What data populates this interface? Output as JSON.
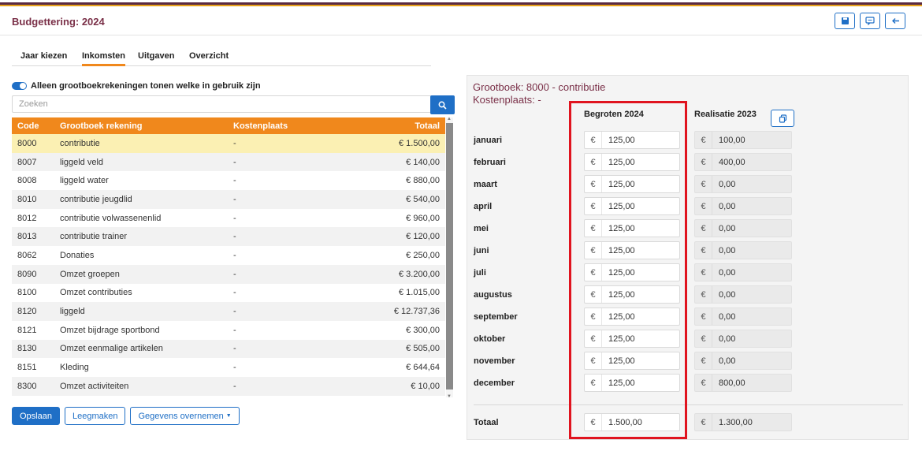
{
  "header": {
    "title": "Budgettering: 2024"
  },
  "tabs": [
    {
      "label": "Jaar kiezen"
    },
    {
      "label": "Inkomsten"
    },
    {
      "label": "Uitgaven"
    },
    {
      "label": "Overzicht"
    }
  ],
  "filter": {
    "toggle_label": "Alleen grootboekrekeningen tonen welke in gebruik zijn",
    "toggle_on": true
  },
  "search": {
    "placeholder": "Zoeken"
  },
  "table": {
    "headers": [
      "Code",
      "Grootboek rekening",
      "Kostenplaats",
      "Totaal"
    ],
    "rows": [
      {
        "code": "8000",
        "name": "contributie",
        "kp": "-",
        "total": "€ 1.500,00"
      },
      {
        "code": "8007",
        "name": "liggeld veld",
        "kp": "-",
        "total": "€ 140,00"
      },
      {
        "code": "8008",
        "name": "liggeld water",
        "kp": "-",
        "total": "€ 880,00"
      },
      {
        "code": "8010",
        "name": "contributie jeugdlid",
        "kp": "-",
        "total": "€ 540,00"
      },
      {
        "code": "8012",
        "name": "contributie volwassenenlid",
        "kp": "-",
        "total": "€ 960,00"
      },
      {
        "code": "8013",
        "name": "contributie trainer",
        "kp": "-",
        "total": "€ 120,00"
      },
      {
        "code": "8062",
        "name": "Donaties",
        "kp": "-",
        "total": "€ 250,00"
      },
      {
        "code": "8090",
        "name": "Omzet groepen",
        "kp": "-",
        "total": "€ 3.200,00"
      },
      {
        "code": "8100",
        "name": "Omzet contributies",
        "kp": "-",
        "total": "€ 1.015,00"
      },
      {
        "code": "8120",
        "name": "liggeld",
        "kp": "-",
        "total": "€ 12.737,36"
      },
      {
        "code": "8121",
        "name": "Omzet bijdrage sportbond",
        "kp": "-",
        "total": "€ 300,00"
      },
      {
        "code": "8130",
        "name": "Omzet eenmalige artikelen",
        "kp": "-",
        "total": "€ 505,00"
      },
      {
        "code": "8151",
        "name": "Kleding",
        "kp": "-",
        "total": "€ 644,64"
      },
      {
        "code": "8300",
        "name": "Omzet activiteiten",
        "kp": "-",
        "total": "€ 10,00"
      }
    ]
  },
  "buttons": {
    "save": "Opslaan",
    "clear": "Leegmaken",
    "copy": "Gegevens overnemen"
  },
  "detail": {
    "grootboek": "Grootboek: 8000  -  contributie",
    "kostenplaats": "Kostenplaats: -",
    "col_budget": "Begroten 2024",
    "col_real": "Realisatie 2023",
    "currency": "€",
    "months": [
      {
        "label": "januari",
        "budget": "125,00",
        "real": "100,00"
      },
      {
        "label": "februari",
        "budget": "125,00",
        "real": "400,00"
      },
      {
        "label": "maart",
        "budget": "125,00",
        "real": "0,00"
      },
      {
        "label": "april",
        "budget": "125,00",
        "real": "0,00"
      },
      {
        "label": "mei",
        "budget": "125,00",
        "real": "0,00"
      },
      {
        "label": "juni",
        "budget": "125,00",
        "real": "0,00"
      },
      {
        "label": "juli",
        "budget": "125,00",
        "real": "0,00"
      },
      {
        "label": "augustus",
        "budget": "125,00",
        "real": "0,00"
      },
      {
        "label": "september",
        "budget": "125,00",
        "real": "0,00"
      },
      {
        "label": "oktober",
        "budget": "125,00",
        "real": "0,00"
      },
      {
        "label": "november",
        "budget": "125,00",
        "real": "0,00"
      },
      {
        "label": "december",
        "budget": "125,00",
        "real": "800,00"
      }
    ],
    "total_label": "Totaal",
    "total_budget": "1.500,00",
    "total_real": "1.300,00"
  },
  "colors": {
    "accent": "#f0881c",
    "primary": "#1f6fc6",
    "title": "#7a3048",
    "highlight": "#e0141f"
  }
}
